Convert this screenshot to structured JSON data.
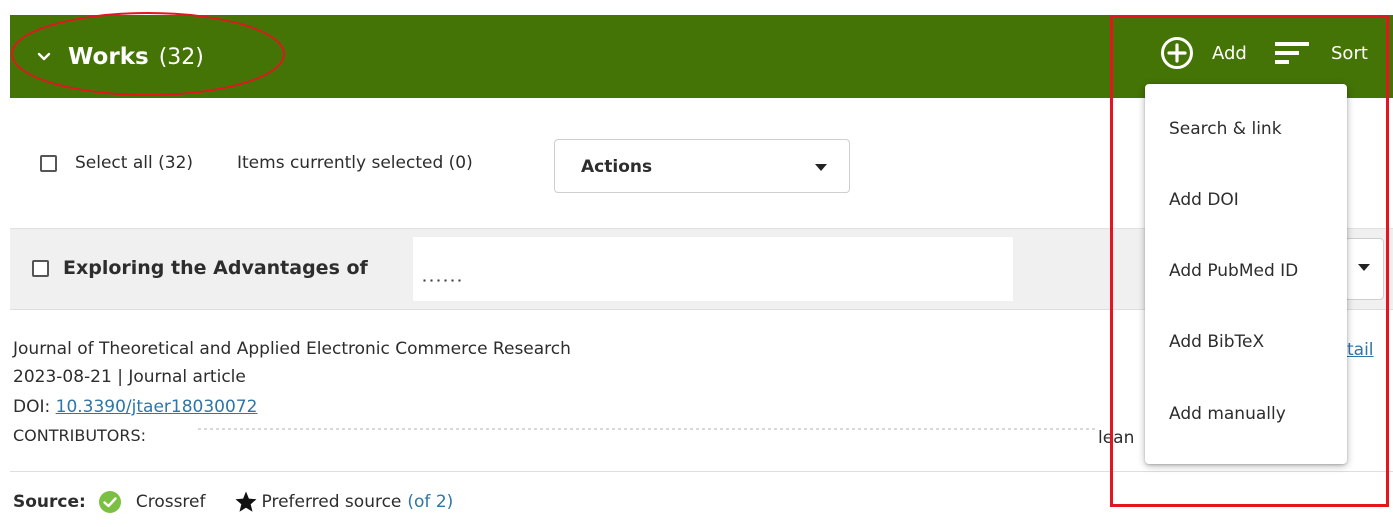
{
  "header": {
    "title": "Works",
    "count": "(32)",
    "add_label": "Add",
    "sort_label": "Sort",
    "color": "#447405"
  },
  "toolbar": {
    "select_all": "Select all (32)",
    "items_selected": "Items currently selected (0)",
    "actions_label": "Actions"
  },
  "work": {
    "title": "Exploring the Advantages of",
    "journal": "Journal of Theoretical and Applied Electronic Commerce Research",
    "date_type": "2023-08-21 | Journal article",
    "doi_label": "DOI:",
    "doi_value": "10.3390/jtaer18030072",
    "contributors_label": "CONTRIBUTORS:",
    "contributors_tail": "lean",
    "detail_link": "tail",
    "source_label": "Source:",
    "source_name": "Crossref",
    "preferred_label": "Preferred source",
    "preferred_count": "(of 2)"
  },
  "add_menu": {
    "items": [
      "Search & link",
      "Add DOI",
      "Add PubMed ID",
      "Add BibTeX",
      "Add manually"
    ]
  },
  "colors": {
    "highlight": "#e4151f",
    "link": "#2e75a8",
    "check": "#7bc043"
  }
}
